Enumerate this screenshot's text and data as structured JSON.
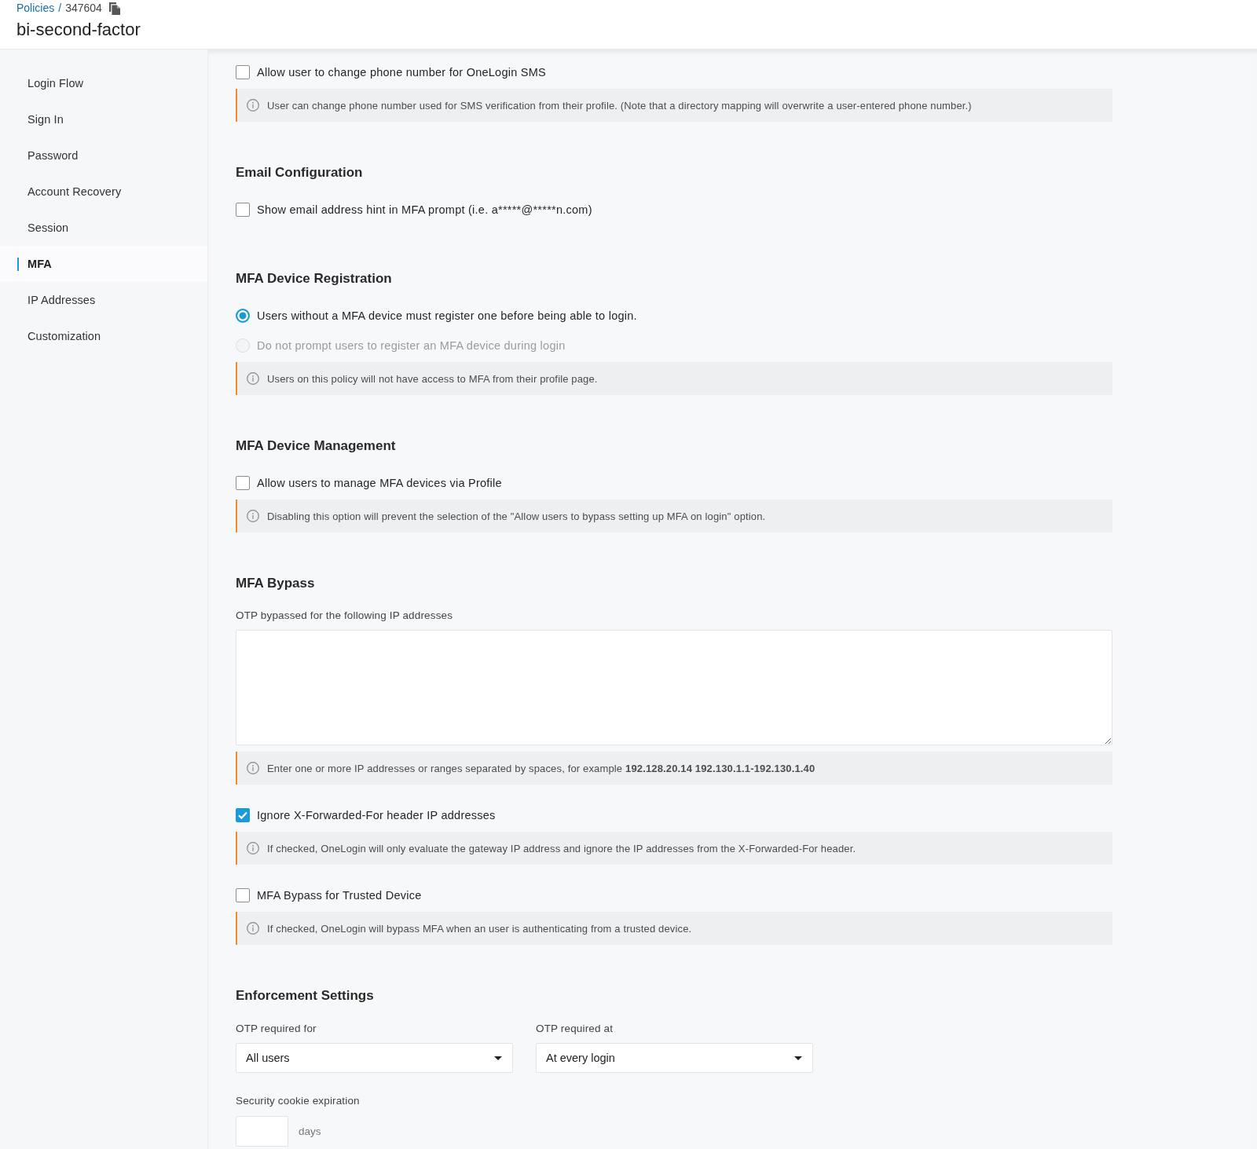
{
  "header": {
    "breadcrumb": {
      "parent": "Policies",
      "separator": "/",
      "current": "347604"
    },
    "title": "bi-second-factor"
  },
  "sidebar": {
    "items": [
      {
        "label": "Login Flow",
        "selected": false
      },
      {
        "label": "Sign In",
        "selected": false
      },
      {
        "label": "Password",
        "selected": false
      },
      {
        "label": "Account Recovery",
        "selected": false
      },
      {
        "label": "Session",
        "selected": false
      },
      {
        "label": "MFA",
        "selected": true
      },
      {
        "label": "IP Addresses",
        "selected": false
      },
      {
        "label": "Customization",
        "selected": false
      }
    ]
  },
  "sections": [
    {
      "items": [
        {
          "kind": "checkbox",
          "label": "Allow user to change phone number for OneLogin SMS",
          "checked": false
        },
        {
          "kind": "info",
          "text": "User can change phone number used for SMS verification from their profile. (Note that a directory mapping will overwrite a user-entered phone number.)"
        }
      ]
    },
    {
      "heading": "Email Configuration",
      "items": [
        {
          "kind": "checkbox",
          "label": "Show email address hint in MFA prompt (i.e. a*****@*****n.com)",
          "checked": false
        }
      ]
    },
    {
      "heading": "MFA Device Registration",
      "items": [
        {
          "kind": "radio",
          "label": "Users without a MFA device must register one before being able to login.",
          "selected": true,
          "disabled": false
        },
        {
          "kind": "radio",
          "label": "Do not prompt users to register an MFA device during login",
          "selected": false,
          "disabled": true
        },
        {
          "kind": "info",
          "text": "Users on this policy will not have access to MFA from their profile page."
        }
      ]
    },
    {
      "heading": "MFA Device Management",
      "items": [
        {
          "kind": "checkbox",
          "label": "Allow users to manage MFA devices via Profile",
          "checked": false
        },
        {
          "kind": "info",
          "text": "Disabling this option will prevent the selection of the \"Allow users to bypass setting up MFA on login\" option."
        }
      ]
    },
    {
      "heading": "MFA Bypass",
      "items": [
        {
          "kind": "textarea",
          "label": "OTP bypassed for the following IP addresses"
        },
        {
          "kind": "info",
          "text": "Enter one or more IP addresses or ranges separated by spaces, for example **192.128.20.14 192.130.1.1-192.130.1.40**"
        },
        {
          "kind": "checkbox",
          "label": "Ignore X-Forwarded-For header IP addresses",
          "checked": true
        },
        {
          "kind": "info",
          "text": "If checked, OneLogin will only evaluate the gateway IP address and ignore the IP addresses from the X-Forwarded-For header."
        },
        {
          "kind": "checkbox",
          "label": "MFA Bypass for Trusted Device",
          "checked": false
        },
        {
          "kind": "info",
          "text": "If checked, OneLogin will bypass MFA when an user is authenticating from a trusted device."
        }
      ]
    },
    {
      "heading": "Enforcement Settings",
      "items": [
        {
          "kind": "dropdowns",
          "fields": [
            {
              "label": "OTP required for",
              "value": "All users"
            },
            {
              "label": "OTP required at",
              "value": "At every login"
            }
          ]
        },
        {
          "kind": "number",
          "label": "Security cookie expiration",
          "unit": "days"
        }
      ]
    }
  ]
}
